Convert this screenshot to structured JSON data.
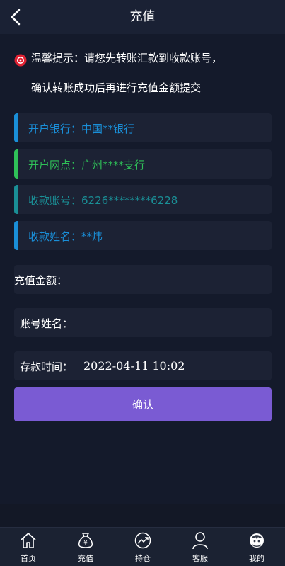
{
  "header": {
    "title": "充值",
    "back_icon": "chevron-left-icon"
  },
  "notice": {
    "icon": "alert-icon",
    "icon_color": "#e02233",
    "line1": "温馨提示：请您先转账汇款到收款账号，",
    "line2": "确认转账成功后再进行充值金额提交"
  },
  "bank_info": [
    {
      "text": "开户银行：中国**银行",
      "color": "#1a8fd8"
    },
    {
      "text": "开户网点：广州****支行",
      "color": "#2fc158"
    },
    {
      "text": "收款账号：6226********6228",
      "color": "#1a8f96"
    },
    {
      "text": "收款姓名：**炜",
      "color": "#1a8fd8"
    }
  ],
  "form": {
    "amount_label": "充值金额：",
    "amount_value": "",
    "name_label": "账号姓名：",
    "name_value": "",
    "time_label": "存款时间：",
    "time_value": "2022-04-11 10:02"
  },
  "confirm_label": "确认",
  "accent_color": "#7a5bd3",
  "tabbar": [
    {
      "label": "首页",
      "icon": "home-icon"
    },
    {
      "label": "充值",
      "icon": "money-bag-icon"
    },
    {
      "label": "持仓",
      "icon": "chart-trend-icon"
    },
    {
      "label": "客服",
      "icon": "user-icon"
    },
    {
      "label": "我的",
      "icon": "avatar-icon"
    }
  ]
}
